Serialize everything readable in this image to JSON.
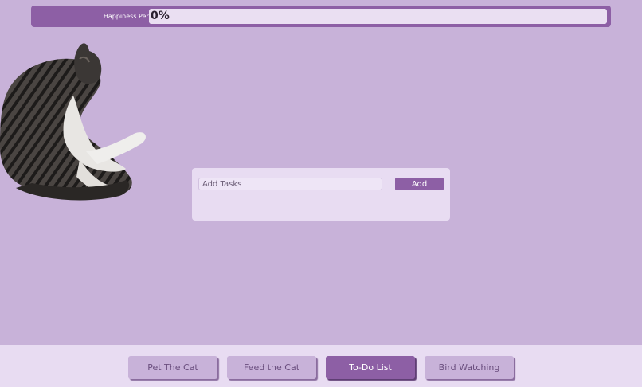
{
  "happiness": {
    "label": "Happiness Percentage",
    "value_text": "0%",
    "progress_fraction": 0
  },
  "todo": {
    "input_placeholder": "Add Tasks",
    "input_value": "",
    "add_label": "Add"
  },
  "nav": {
    "items": [
      {
        "label": "Pet The Cat",
        "active": false
      },
      {
        "label": "Feed the Cat",
        "active": false
      },
      {
        "label": "To-Do List",
        "active": true
      },
      {
        "label": "Bird Watching",
        "active": false
      }
    ]
  },
  "colors": {
    "background": "#c8b2d9",
    "accent": "#8d5fa5",
    "panel": "#e8dcf2"
  },
  "icons": {
    "cat": "cat-photo"
  }
}
